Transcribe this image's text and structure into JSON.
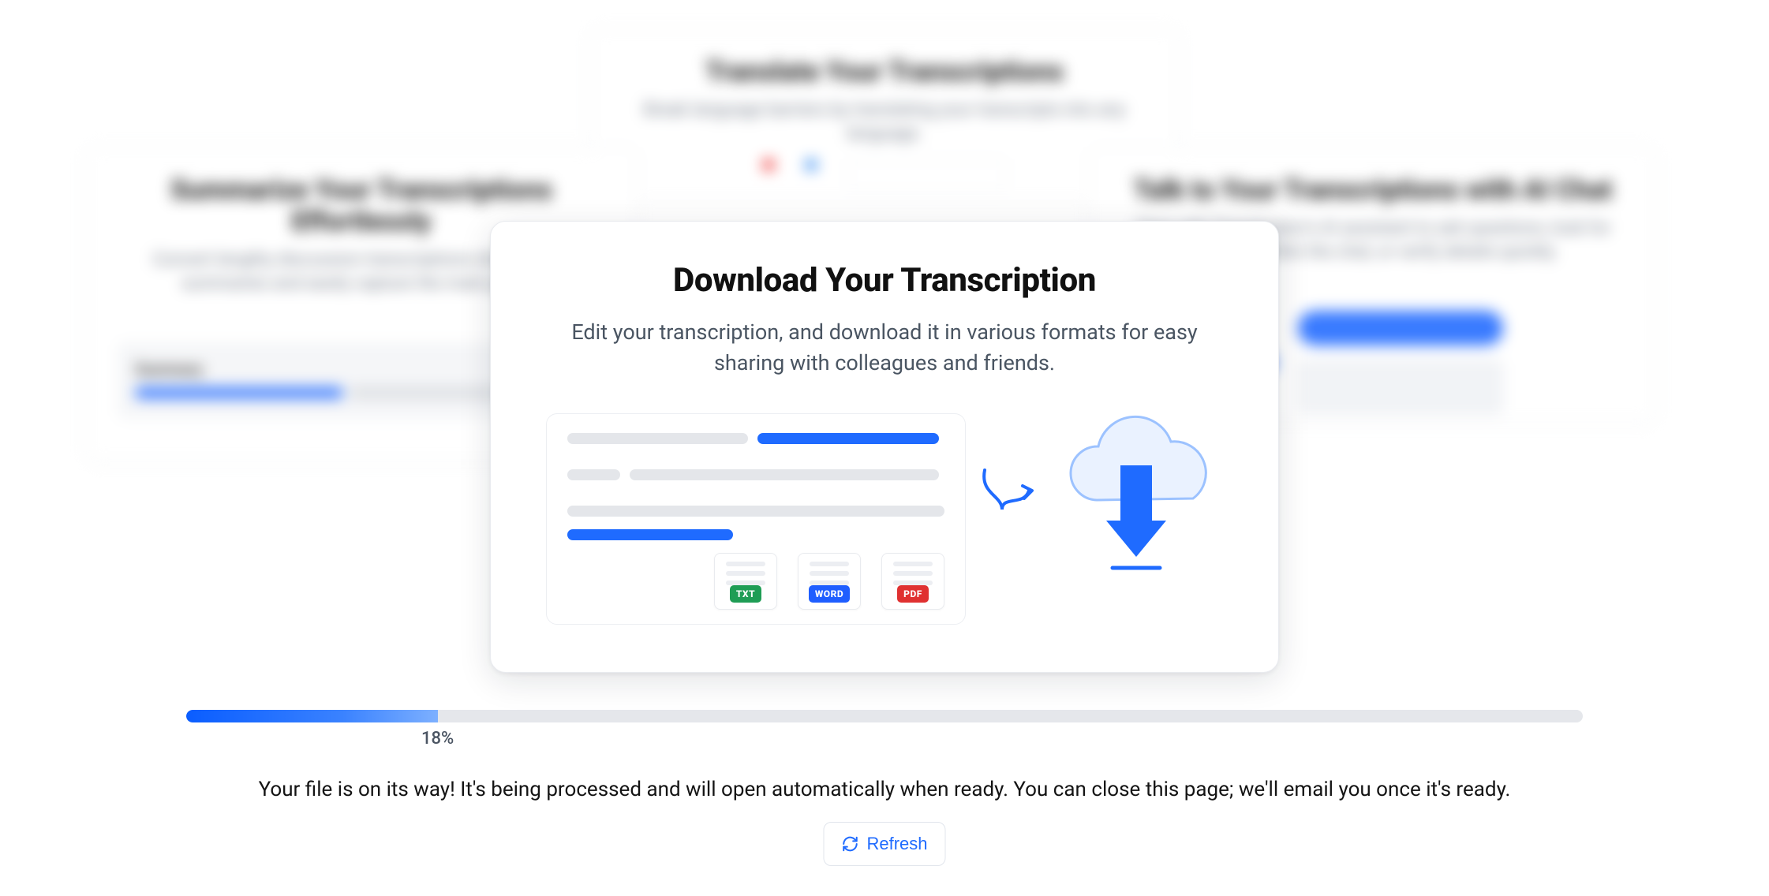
{
  "bg_cards": {
    "top": {
      "title": "Translate Your Transcriptions",
      "desc": "Break language barriers by translating your transcripts into any language."
    },
    "left": {
      "title": "Summarize Your Transcriptions Effortlessly",
      "desc": "Convert lengthy discussion transcriptions into concise summaries and easily capture the main points.",
      "summary_label": "Summary"
    },
    "right": {
      "title": "Talk to Your Transcriptions with AI Chat",
      "desc": "Chat with Transkriptor's AI assistant to ask questions, look for answers within the chat, or verify details quickly."
    }
  },
  "main": {
    "title": "Download Your Transcription",
    "subtitle": "Edit your transcription, and download it in various formats for easy sharing with colleagues and friends.",
    "formats": {
      "txt": "TXT",
      "word": "WORD",
      "pdf": "PDF"
    }
  },
  "progress": {
    "percent": 18,
    "percent_label": "18%"
  },
  "status_message": "Your file is on its way! It's being processed and will open automatically when ready. You can close this page; we'll email you once it's ready.",
  "refresh_label": "Refresh",
  "colors": {
    "accent": "#1f6bff",
    "txt_tag": "#1f9d55",
    "word_tag": "#1f5eff",
    "pdf_tag": "#e03131"
  }
}
